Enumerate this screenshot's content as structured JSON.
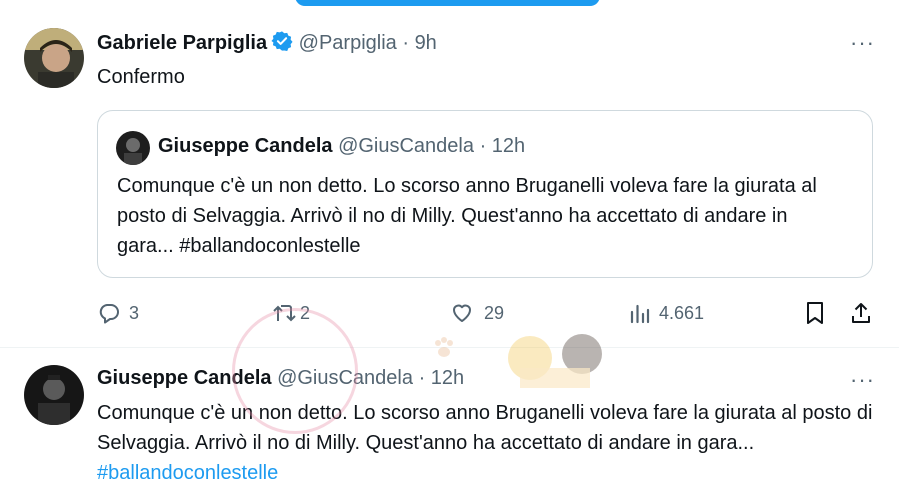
{
  "post": {
    "author_name": "Gabriele Parpiglia",
    "handle": "@Parpiglia",
    "separator": "·",
    "time": "9h",
    "text": "Confermo",
    "more_label": "···",
    "quote": {
      "author_name": "Giuseppe Candela",
      "handle": "@GiusCandela",
      "separator": "·",
      "time": "12h",
      "text": "Comunque c'è un non detto. Lo scorso anno Bruganelli voleva fare la giurata al posto di Selvaggia. Arrivò il no di Milly. Quest'anno ha accettato di andare in gara...",
      "hashtag": "#ballandoconlestelle"
    },
    "actions": {
      "replies": "3",
      "reposts": "2",
      "likes": "29",
      "views": "4.661"
    }
  },
  "second_post": {
    "author_name": "Giuseppe Candela",
    "handle": "@GiusCandela",
    "separator": "·",
    "time": "12h",
    "text": "Comunque c'è un non detto. Lo scorso anno Bruganelli voleva fare la giurata al posto di Selvaggia. Arrivò il no di Milly. Quest'anno ha accettato di andare in gara...",
    "hashtag": "#ballandoconlestelle",
    "more_label": "···"
  },
  "colors": {
    "accent": "#1d9bf0",
    "text": "#0f1419",
    "secondary": "#536471",
    "border": "#cfd9de"
  },
  "icons": {
    "reply": "reply-icon",
    "repost": "repost-icon",
    "like": "heart-icon",
    "views": "views-icon",
    "bookmark": "bookmark-icon",
    "share": "share-icon",
    "verified": "verified-badge-icon",
    "more": "more-icon"
  }
}
